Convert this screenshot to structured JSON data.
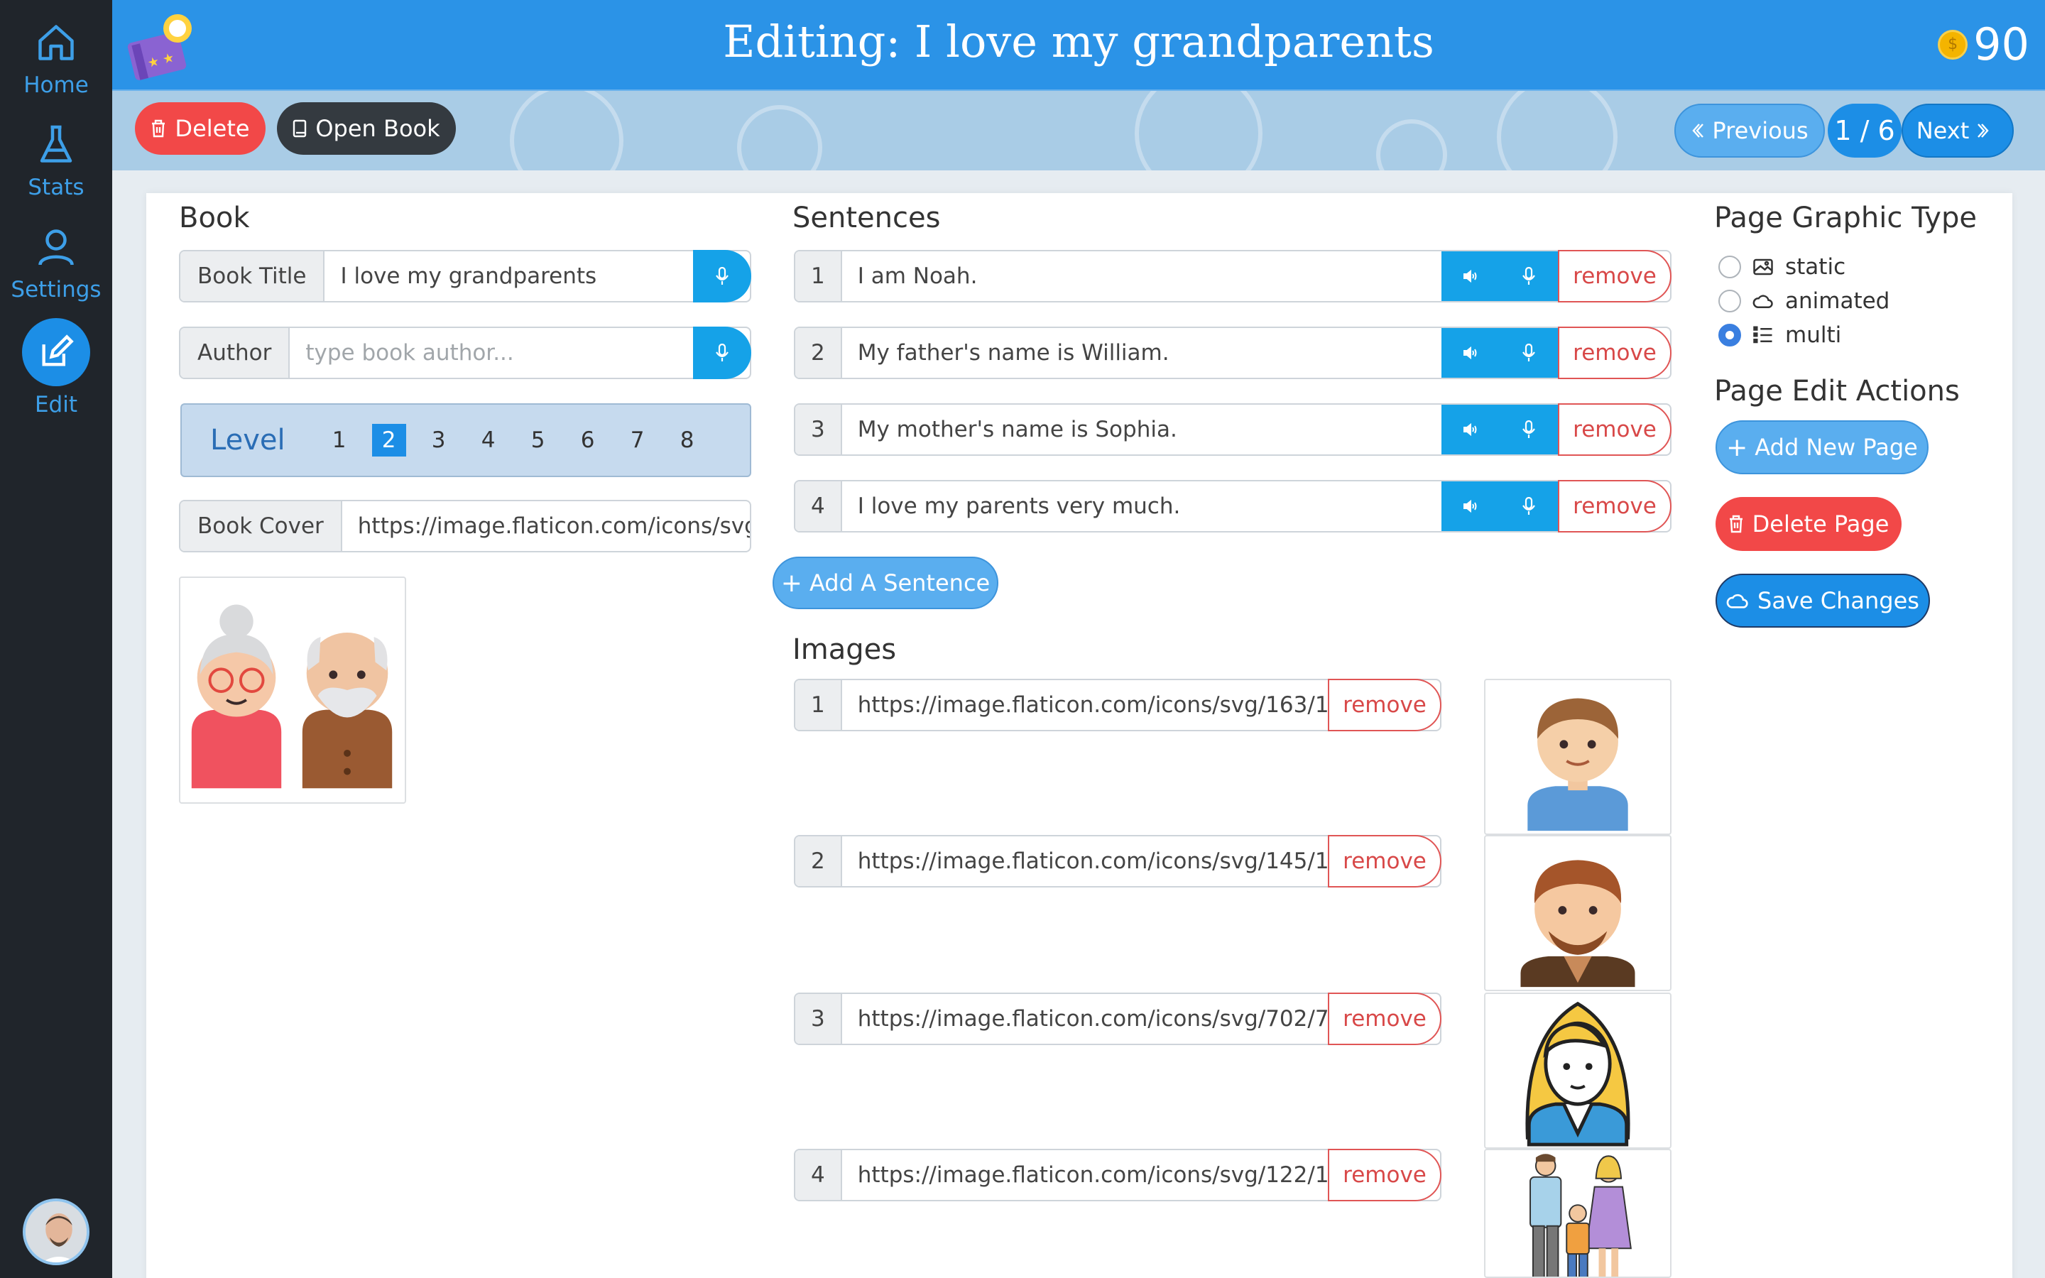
{
  "sidebar": {
    "items": [
      {
        "label": "Home",
        "icon": "home-icon"
      },
      {
        "label": "Stats",
        "icon": "flask-icon"
      },
      {
        "label": "Settings",
        "icon": "user-icon"
      },
      {
        "label": "Edit",
        "icon": "edit-icon"
      }
    ]
  },
  "header": {
    "title": "Editing: I love my grandparents",
    "coins": "90"
  },
  "toolbar": {
    "delete_label": "Delete",
    "open_book_label": "Open Book",
    "previous_label": "Previous",
    "page_indicator": "1 / 6",
    "next_label": "Next"
  },
  "book": {
    "heading": "Book",
    "title_label": "Book Title",
    "title_value": "I love my grandparents",
    "author_label": "Author",
    "author_placeholder": "type book author...",
    "level_label": "Level",
    "levels": [
      "1",
      "2",
      "3",
      "4",
      "5",
      "6",
      "7",
      "8"
    ],
    "selected_level": "2",
    "cover_label": "Book Cover",
    "cover_value": "https://image.flaticon.com/icons/svg/3"
  },
  "sentences": {
    "heading": "Sentences",
    "remove_label": "remove",
    "add_label": "Add A Sentence",
    "items": [
      {
        "num": "1",
        "text": "I am Noah."
      },
      {
        "num": "2",
        "text": "My father's name is William."
      },
      {
        "num": "3",
        "text": "My mother's name is Sophia."
      },
      {
        "num": "4",
        "text": "I love my parents very much."
      }
    ]
  },
  "images": {
    "heading": "Images",
    "remove_label": "remove",
    "items": [
      {
        "num": "1",
        "url": "https://image.flaticon.com/icons/svg/163/163"
      },
      {
        "num": "2",
        "url": "https://image.flaticon.com/icons/svg/145/145"
      },
      {
        "num": "3",
        "url": "https://image.flaticon.com/icons/svg/702/702"
      },
      {
        "num": "4",
        "url": "https://image.flaticon.com/icons/svg/122/122"
      }
    ]
  },
  "page_graphic": {
    "heading": "Page Graphic Type",
    "options": [
      {
        "label": "static",
        "icon": "image-icon"
      },
      {
        "label": "animated",
        "icon": "cloud-icon"
      },
      {
        "label": "multi",
        "icon": "list-icon"
      }
    ],
    "selected": "multi"
  },
  "page_actions": {
    "heading": "Page Edit Actions",
    "add_page_label": "Add New Page",
    "delete_page_label": "Delete Page",
    "save_label": "Save Changes"
  },
  "colors": {
    "header_blue": "#2b93e7",
    "sidebar_dark": "#20252b",
    "accent_blue": "#15a2e8",
    "danger_red": "#f24848",
    "dark_button": "#343a40"
  }
}
